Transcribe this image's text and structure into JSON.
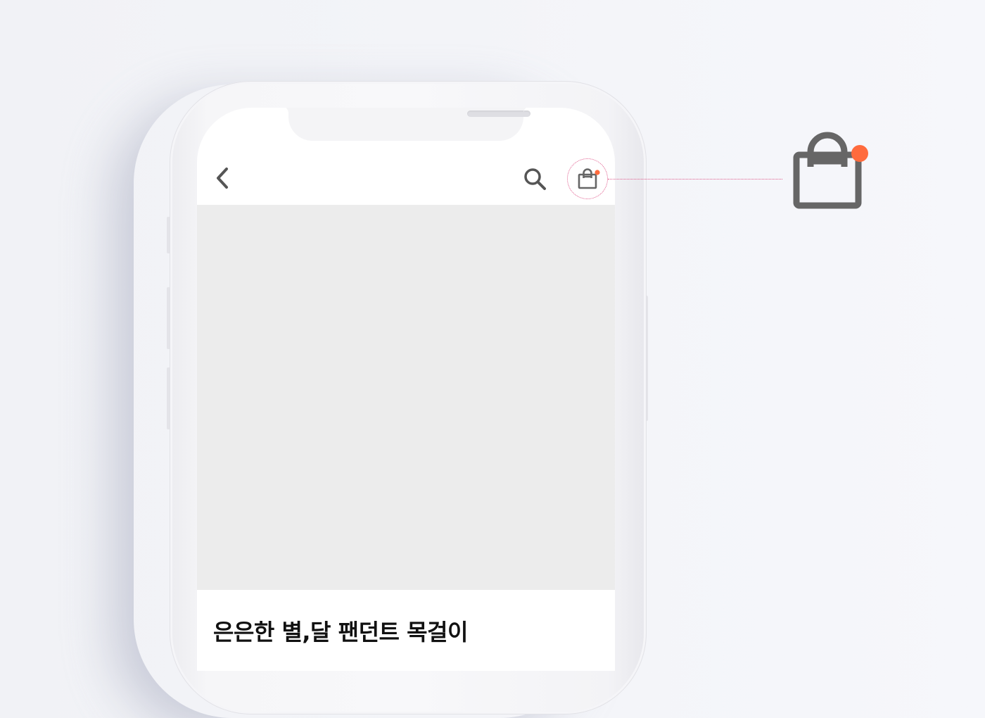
{
  "header": {
    "back_icon": "chevron-left-icon",
    "search_icon": "search-icon",
    "cart_icon": "shopping-bag-icon",
    "cart_badge_color": "#ff6b3d",
    "icon_color": "#6a6a6a"
  },
  "product": {
    "title": "은은한 별,달 팬던트 목걸이",
    "image_placeholder_color": "#ececec"
  },
  "callout": {
    "icon": "shopping-bag-icon",
    "highlight_color": "#e05a8c",
    "badge_color": "#ff6b3d"
  }
}
